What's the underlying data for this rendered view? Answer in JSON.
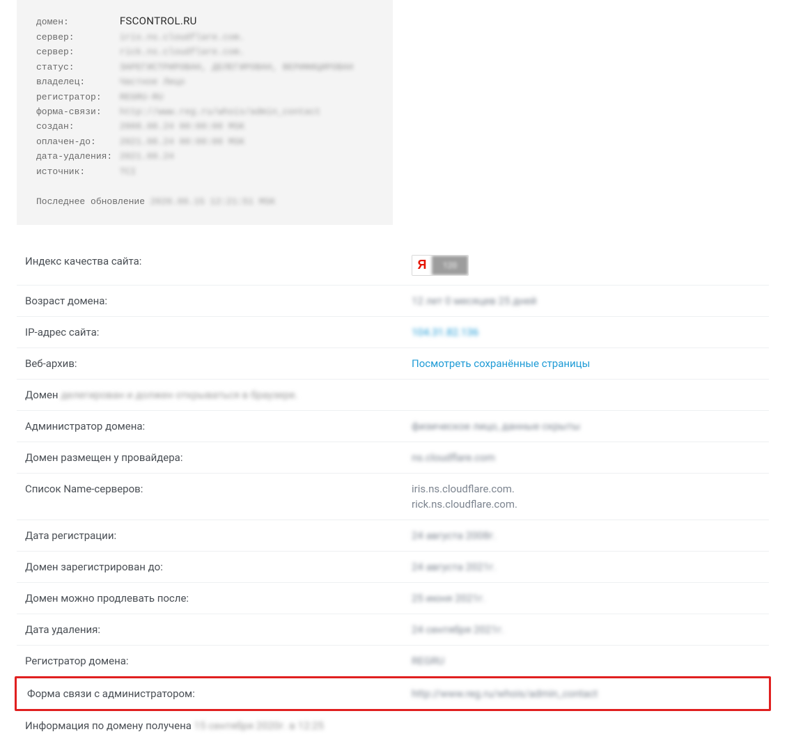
{
  "whois": {
    "rows": [
      {
        "key": "домен:",
        "val": "FSCONTROL.RU",
        "clear": true
      },
      {
        "key": "сервер:",
        "val": "iris.ns.cloudflare.com."
      },
      {
        "key": "сервер:",
        "val": "rick.ns.cloudflare.com."
      },
      {
        "key": "статус:",
        "val": "ЗАРЕГИСТРИРОВАН, ДЕЛЕГИРОВАН, ВЕРИФИЦИРОВАН"
      },
      {
        "key": "владелец:",
        "val": "Частное Лицо"
      },
      {
        "key": "регистратор:",
        "val": "REGRU-RU"
      },
      {
        "key": "форма-связи:",
        "val": "http://www.reg.ru/whois/admin_contact"
      },
      {
        "key": "создан:",
        "val": "2008.08.24 00:00:00 MSK"
      },
      {
        "key": "оплачен-до:",
        "val": "2021.08.24 00:00:00 MSK"
      },
      {
        "key": "дата-удаления:",
        "val": "2021.09.24"
      },
      {
        "key": "источник:",
        "val": "TCI"
      }
    ],
    "footer_label": "Последнее обновление",
    "footer_value": "2020.09.15 12:21:51 MSK"
  },
  "quality": {
    "label": "Индекс качества сайта:",
    "ya_letter": "Я",
    "ya_value": "120"
  },
  "age": {
    "label": "Возраст домена:",
    "value": "12 лет 0 месяцев 25 дней"
  },
  "ip": {
    "label": "IP-адрес сайта:",
    "value": "104.31.82.136"
  },
  "archive": {
    "label": "Веб-архив:",
    "value": "Посмотреть сохранённые страницы"
  },
  "delegated": {
    "prefix": "Домен",
    "rest": "делегирован и должен открываться в браузере."
  },
  "admin": {
    "label": "Администратор домена:",
    "value": "физическое лицо, данные скрыты"
  },
  "provider": {
    "label": "Домен размещен у провайдера:",
    "value": "ns.cloudflare.com"
  },
  "ns": {
    "label": "Список Name-серверов:",
    "values": [
      "iris.ns.cloudflare.com.",
      "rick.ns.cloudflare.com."
    ]
  },
  "reg_date": {
    "label": "Дата регистрации:",
    "value": "24 августа 2008г."
  },
  "reg_until": {
    "label": "Домен зарегистрирован до:",
    "value": "24 августа 2021г."
  },
  "renew_after": {
    "label": "Домен можно продлевать после:",
    "value": "25 июня 2021г."
  },
  "del_date": {
    "label": "Дата удаления:",
    "value": "24 сентября 2021г."
  },
  "registrar": {
    "label": "Регистратор домена:",
    "value": "REGRU"
  },
  "contact_form": {
    "label": "Форма связи с администратором:",
    "value": "http://www.reg.ru/whois/admin_contact"
  },
  "info_received": {
    "prefix": "Информация по домену получена",
    "rest": "15 сентября 2020г. в 12:25"
  }
}
